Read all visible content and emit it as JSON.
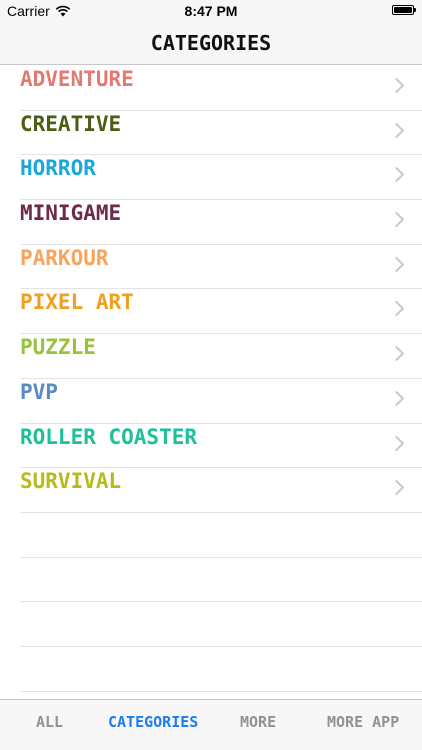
{
  "status_bar": {
    "carrier": "Carrier",
    "time": "8:47 PM"
  },
  "nav": {
    "title": "CATEGORIES"
  },
  "categories": [
    {
      "label": "ADVENTURE",
      "color": "#e07a72"
    },
    {
      "label": "CREATIVE",
      "color": "#4a5e14"
    },
    {
      "label": "HORROR",
      "color": "#1aa8dc"
    },
    {
      "label": "MINIGAME",
      "color": "#6e2a4a"
    },
    {
      "label": "PARKOUR",
      "color": "#f9a45c"
    },
    {
      "label": "PIXEL ART",
      "color": "#f0a020"
    },
    {
      "label": "PUZZLE",
      "color": "#98c23c"
    },
    {
      "label": "PVP",
      "color": "#5a8ac4"
    },
    {
      "label": "ROLLER COASTER",
      "color": "#1cc09a"
    },
    {
      "label": "SURVIVAL",
      "color": "#b8ba1c"
    }
  ],
  "tabs": [
    {
      "label": "ALL",
      "active": false
    },
    {
      "label": "CATEGORIES",
      "active": true
    },
    {
      "label": "MORE",
      "active": false
    },
    {
      "label": "MORE APP",
      "active": false
    }
  ],
  "colors": {
    "active_tab": "#1a7df0",
    "inactive_tab": "#929292",
    "chevron": "#c7c7cc"
  }
}
